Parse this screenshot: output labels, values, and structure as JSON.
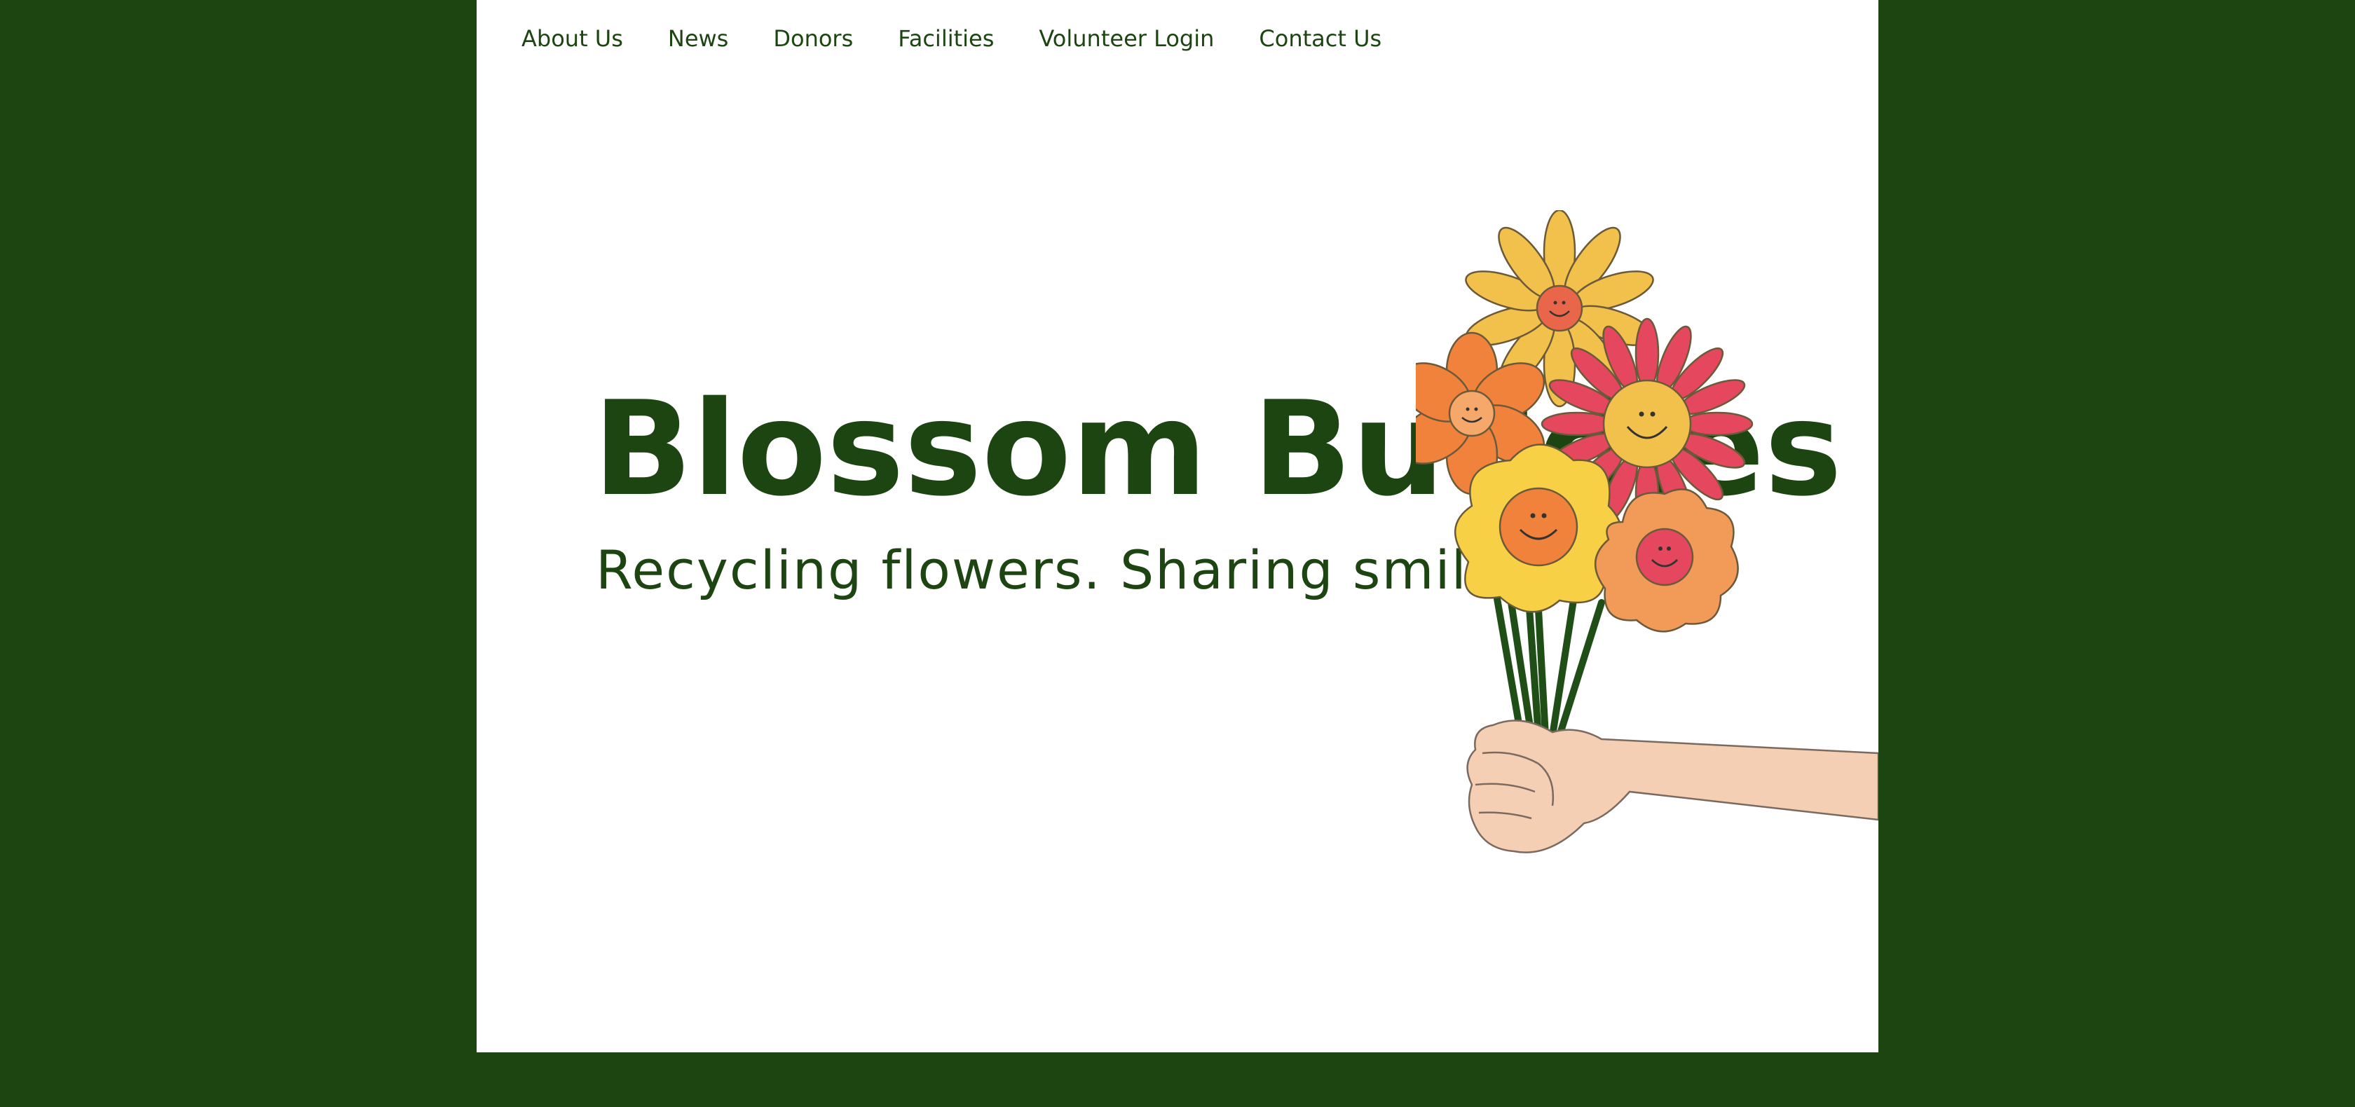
{
  "nav": {
    "items": [
      {
        "label": "About Us"
      },
      {
        "label": "News"
      },
      {
        "label": "Donors"
      },
      {
        "label": "Facilities"
      },
      {
        "label": "Volunteer Login"
      },
      {
        "label": "Contact Us"
      }
    ]
  },
  "hero": {
    "title": "Blossom Buddies",
    "tagline": "Recycling flowers. Sharing smiles."
  },
  "colors": {
    "background": "#1c4511",
    "panel": "#ffffff",
    "text": "#1c4511",
    "flower_yellow": "#f2c14b",
    "flower_red": "#e5475f",
    "flower_orange": "#f0823c",
    "skin": "#f5cfb4"
  }
}
